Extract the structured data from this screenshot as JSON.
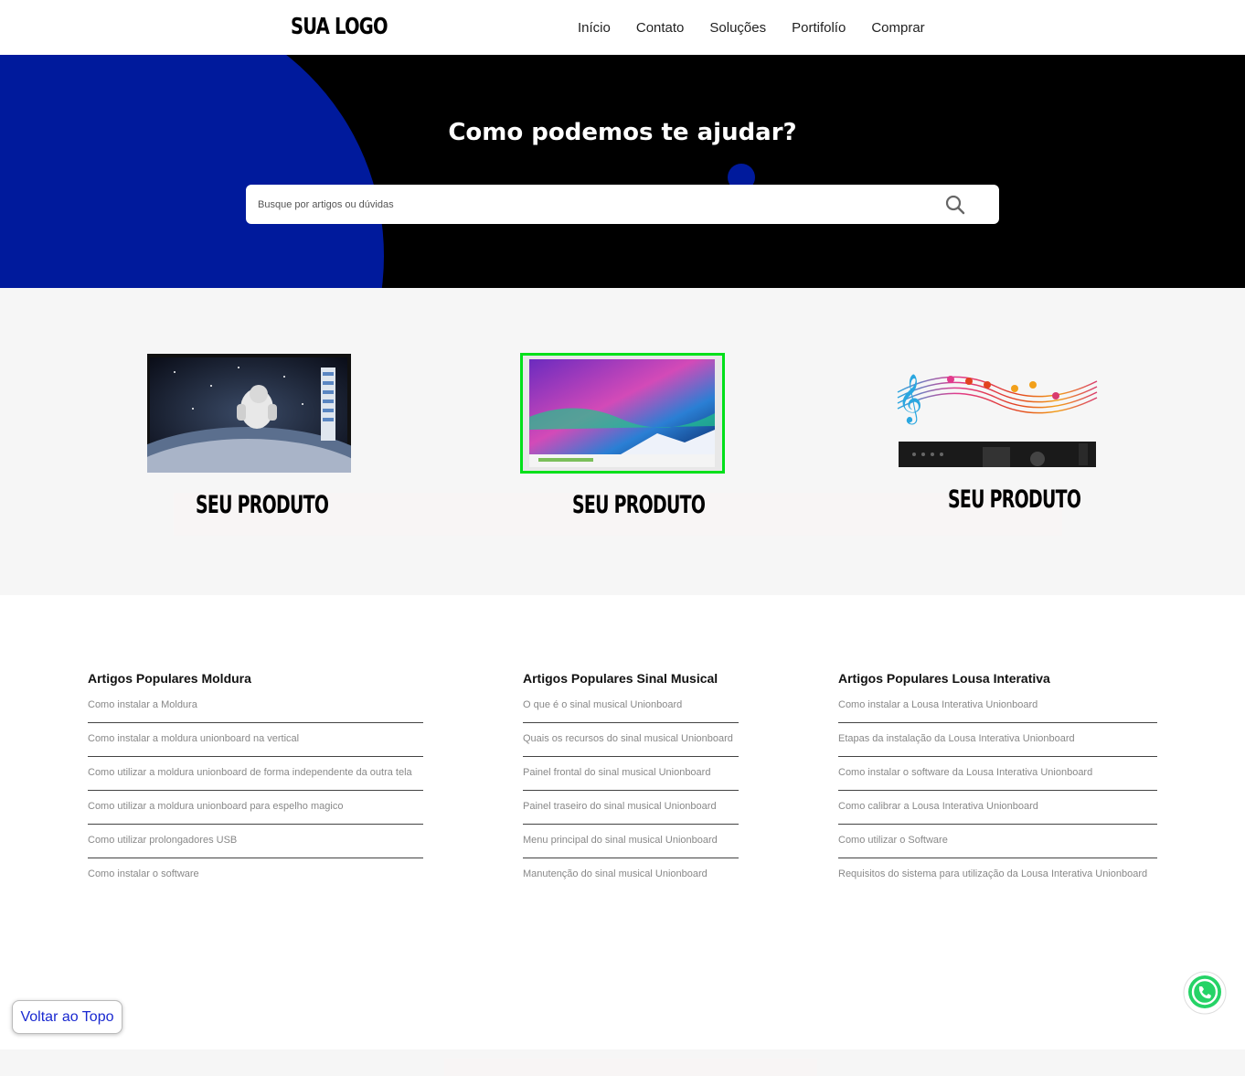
{
  "header": {
    "logo": "SUA LOGO",
    "nav": [
      "Início",
      "Contato",
      "Soluções",
      "Portifolío",
      "Comprar"
    ]
  },
  "hero": {
    "title": "Como podemos te ajudar?",
    "search_placeholder": "Busque por artigos ou dúvidas",
    "search_icon": "search-icon"
  },
  "products": [
    {
      "label": "SEU PRODUTO",
      "image": "astronaut-screen"
    },
    {
      "label": "SEU PRODUTO",
      "image": "aurora-screen"
    },
    {
      "label": "SEU PRODUTO",
      "image": "music-amplifier"
    }
  ],
  "articles": {
    "moldura": {
      "title": "Artigos Populares Moldura",
      "items": [
        "Como instalar a Moldura",
        "Como instalar a moldura unionboard na vertical",
        "Como utilizar a moldura unionboard de forma independente da outra tela",
        "Como utilizar a moldura unionboard para espelho magico",
        "Como utilizar prolongadores USB",
        "Como instalar o software"
      ]
    },
    "sinal": {
      "title": "Artigos Populares Sinal Musical",
      "items": [
        "O que é o sinal musical Unionboard",
        "Quais os recursos do sinal musical Unionboard",
        "Painel frontal do sinal musical Unionboard",
        "Painel traseiro do sinal musical Unionboard",
        "Menu principal do sinal musical Unionboard",
        "Manutenção do sinal musical Unionboard"
      ]
    },
    "lousa": {
      "title": "Artigos Populares Lousa Interativa",
      "items": [
        "Como instalar a Lousa Interativa Unionboard",
        "Etapas da instalação da Lousa Interativa Unionboard",
        "Como instalar o software da Lousa Interativa Unionboard",
        "Como calibrar a Lousa Interativa Unionboard",
        "Como utilizar o Software",
        "Requisitos do sistema para utilização da Lousa Interativa Unionboard"
      ]
    }
  },
  "back_to_top": "Voltar ao Topo",
  "whatsapp_icon": "whatsapp-icon",
  "colors": {
    "accent": "#001a9c",
    "hero_bg": "#000000",
    "link": "#1a29d0",
    "highlight": "#00e01a"
  }
}
